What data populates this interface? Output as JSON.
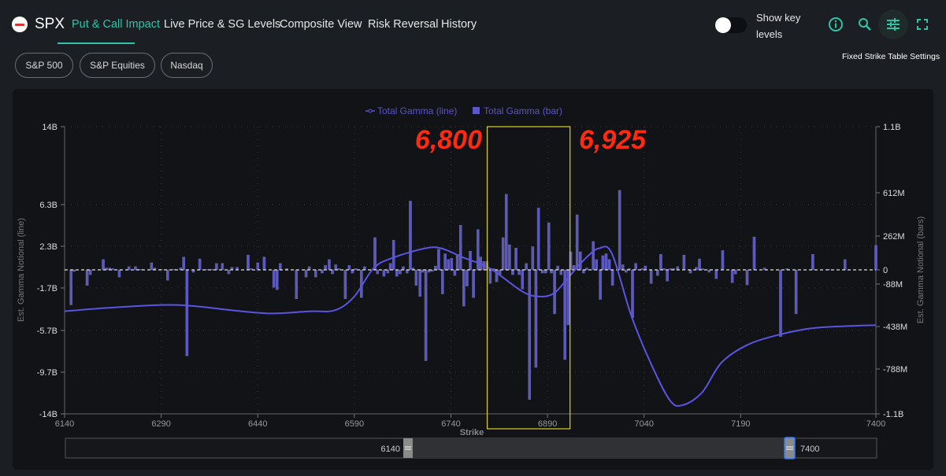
{
  "header": {
    "ticker": "SPX",
    "tabs": [
      {
        "label": "Put & Call Impact",
        "active": true
      },
      {
        "label": "Live Price & SG Levels",
        "active": false
      },
      {
        "label": "Composite View",
        "active": false
      },
      {
        "label": "Risk Reversal",
        "active": false
      },
      {
        "label": "History",
        "active": false
      }
    ],
    "toggle_label": "Show key levels",
    "toggle_on": false,
    "icons": [
      "info-icon",
      "search-icon",
      "sliders-icon",
      "fullscreen-icon"
    ],
    "tooltip": "Fixed Strike Table Settings",
    "accent": "#2ec4a6"
  },
  "filters": [
    "S&P 500",
    "S&P Equities",
    "Nasdaq"
  ],
  "annotations": {
    "left_label": "6,800",
    "right_label": "6,925",
    "range": [
      6800,
      6925
    ],
    "box_color": "#d8d02a",
    "label_color": "#ff2a0f"
  },
  "slider": {
    "min_label": "6140",
    "max_label": "7400",
    "min": 6140,
    "max": 7400
  },
  "chart_data": {
    "type": "bar+line",
    "xlabel": "Strike",
    "ylabel_left": "Est. Gamma Notional (line)",
    "ylabel_right": "Est. Gamma Notional (bars)",
    "x_ticks": [
      "6140",
      "6290",
      "6440",
      "6590",
      "6740",
      "6890",
      "7040",
      "7190",
      "7400"
    ],
    "x_tick_values": [
      6140,
      6290,
      6440,
      6590,
      6740,
      6890,
      7040,
      7190,
      7400
    ],
    "xlim": [
      6140,
      7400
    ],
    "left_ticks": [
      "14B",
      "6.3B",
      "2.3B",
      "-1.7B",
      "-5.7B",
      "-9.7B",
      "-14B"
    ],
    "left_tick_values": [
      14,
      6.3,
      2.3,
      -1.7,
      -5.7,
      -9.7,
      -14
    ],
    "right_ticks": [
      "1.1B",
      "612M",
      "262M",
      "0",
      "-88M",
      "-438M",
      "-788M",
      "-1.1B"
    ],
    "right_tick_values": [
      1100,
      612,
      262,
      0,
      -88,
      -438,
      -788,
      -1100
    ],
    "grid": true,
    "legend_position": "top-center",
    "series": [
      {
        "name": "Total Gamma (line)",
        "kind": "line",
        "axis": "left",
        "unit": "B",
        "color": "#5b54d6",
        "points": [
          [
            6140,
            -3.9
          ],
          [
            6200,
            -3.6
          ],
          [
            6290,
            -3.3
          ],
          [
            6340,
            -3.4
          ],
          [
            6400,
            -3.8
          ],
          [
            6460,
            -4.1
          ],
          [
            6520,
            -3.9
          ],
          [
            6560,
            -3.8
          ],
          [
            6590,
            -2.5
          ],
          [
            6620,
            0.2
          ],
          [
            6650,
            1.2
          ],
          [
            6700,
            2.1
          ],
          [
            6725,
            2.1
          ],
          [
            6760,
            1.2
          ],
          [
            6800,
            0.2
          ],
          [
            6850,
            -2.0
          ],
          [
            6875,
            -2.5
          ],
          [
            6900,
            -2.2
          ],
          [
            6925,
            -0.5
          ],
          [
            6950,
            1.2
          ],
          [
            6970,
            2.1
          ],
          [
            6990,
            1.6
          ],
          [
            7020,
            -4.3
          ],
          [
            7050,
            -8.8
          ],
          [
            7080,
            -12.6
          ],
          [
            7100,
            -13.1
          ],
          [
            7130,
            -11.8
          ],
          [
            7160,
            -8.8
          ],
          [
            7200,
            -7.1
          ],
          [
            7250,
            -6.1
          ],
          [
            7300,
            -5.5
          ],
          [
            7350,
            -5.3
          ],
          [
            7400,
            -5.2
          ]
        ]
      },
      {
        "name": "Total Gamma (bar)",
        "kind": "bar",
        "axis": "right",
        "unit": "M",
        "color": "#5b57c9",
        "points": [
          [
            6150,
            -260
          ],
          [
            6155,
            -10
          ],
          [
            6175,
            -100
          ],
          [
            6180,
            -30
          ],
          [
            6200,
            80
          ],
          [
            6205,
            15
          ],
          [
            6210,
            15
          ],
          [
            6215,
            10
          ],
          [
            6225,
            -45
          ],
          [
            6240,
            25
          ],
          [
            6250,
            25
          ],
          [
            6255,
            5
          ],
          [
            6260,
            5
          ],
          [
            6275,
            55
          ],
          [
            6280,
            15
          ],
          [
            6290,
            5
          ],
          [
            6300,
            -65
          ],
          [
            6310,
            5
          ],
          [
            6320,
            15
          ],
          [
            6325,
            100
          ],
          [
            6330,
            -680
          ],
          [
            6340,
            -15
          ],
          [
            6350,
            85
          ],
          [
            6360,
            5
          ],
          [
            6370,
            5
          ],
          [
            6376,
            50
          ],
          [
            6385,
            50
          ],
          [
            6395,
            -25
          ],
          [
            6400,
            20
          ],
          [
            6408,
            20
          ],
          [
            6425,
            115
          ],
          [
            6430,
            10
          ],
          [
            6440,
            55
          ],
          [
            6450,
            100
          ],
          [
            6465,
            -115
          ],
          [
            6470,
            -135
          ],
          [
            6475,
            50
          ],
          [
            6485,
            10
          ],
          [
            6500,
            -210
          ],
          [
            6515,
            -45
          ],
          [
            6520,
            25
          ],
          [
            6530,
            -45
          ],
          [
            6540,
            -20
          ],
          [
            6545,
            35
          ],
          [
            6551,
            80
          ],
          [
            6556,
            -25
          ],
          [
            6561,
            40
          ],
          [
            6566,
            10
          ],
          [
            6576,
            -210
          ],
          [
            6582,
            35
          ],
          [
            6587,
            -20
          ],
          [
            6592,
            10
          ],
          [
            6601,
            -200
          ],
          [
            6606,
            25
          ],
          [
            6622,
            250
          ],
          [
            6626,
            -25
          ],
          [
            6636,
            -40
          ],
          [
            6642,
            -20
          ],
          [
            6646,
            50
          ],
          [
            6651,
            230
          ],
          [
            6656,
            -40
          ],
          [
            6661,
            -25
          ],
          [
            6666,
            25
          ],
          [
            6672,
            -20
          ],
          [
            6677,
            545
          ],
          [
            6681,
            15
          ],
          [
            6686,
            -100
          ],
          [
            6692,
            -190
          ],
          [
            6696,
            -15
          ],
          [
            6701,
            -720
          ],
          [
            6706,
            -15
          ],
          [
            6711,
            -10
          ],
          [
            6716,
            30
          ],
          [
            6721,
            160
          ],
          [
            6727,
            -170
          ],
          [
            6731,
            125
          ],
          [
            6736,
            80
          ],
          [
            6741,
            90
          ],
          [
            6746,
            -35
          ],
          [
            6750,
            120
          ],
          [
            6755,
            350
          ],
          [
            6760,
            -270
          ],
          [
            6765,
            -105
          ],
          [
            6770,
            145
          ],
          [
            6775,
            -200
          ],
          [
            6782,
            315
          ],
          [
            6786,
            100
          ],
          [
            6791,
            65
          ],
          [
            6796,
            65
          ],
          [
            6801,
            -85
          ],
          [
            6806,
            10
          ],
          [
            6811,
            -75
          ],
          [
            6816,
            -30
          ],
          [
            6821,
            250
          ],
          [
            6826,
            600
          ],
          [
            6831,
            195
          ],
          [
            6836,
            -30
          ],
          [
            6841,
            170
          ],
          [
            6846,
            -30
          ],
          [
            6851,
            -130
          ],
          [
            6857,
            50
          ],
          [
            6862,
            -1000
          ],
          [
            6867,
            180
          ],
          [
            6872,
            -775
          ],
          [
            6876,
            490
          ],
          [
            6882,
            -20
          ],
          [
            6887,
            -20
          ],
          [
            6892,
            370
          ],
          [
            6896,
            -20
          ],
          [
            6901,
            -334
          ],
          [
            6906,
            30
          ],
          [
            6911,
            -30
          ],
          [
            6917,
            -710
          ],
          [
            6922,
            -425
          ],
          [
            6926,
            140
          ],
          [
            6931,
            35
          ],
          [
            6936,
            434
          ],
          [
            6941,
            140
          ],
          [
            6946,
            -20
          ],
          [
            6951,
            15
          ],
          [
            6961,
            220
          ],
          [
            6966,
            80
          ],
          [
            6972,
            -215
          ],
          [
            6976,
            110
          ],
          [
            6981,
            125
          ],
          [
            6986,
            80
          ],
          [
            6991,
            -100
          ],
          [
            7002,
            630
          ],
          [
            7007,
            40
          ],
          [
            7012,
            -15
          ],
          [
            7017,
            10
          ],
          [
            7022,
            -367
          ],
          [
            7027,
            50
          ],
          [
            7037,
            10
          ],
          [
            7042,
            30
          ],
          [
            7051,
            -85
          ],
          [
            7061,
            -35
          ],
          [
            7066,
            120
          ],
          [
            7071,
            10
          ],
          [
            7076,
            -70
          ],
          [
            7081,
            10
          ],
          [
            7086,
            10
          ],
          [
            7092,
            25
          ],
          [
            7102,
            115
          ],
          [
            7112,
            -20
          ],
          [
            7121,
            20
          ],
          [
            7126,
            85
          ],
          [
            7131,
            10
          ],
          [
            7141,
            -15
          ],
          [
            7152,
            -55
          ],
          [
            7162,
            150
          ],
          [
            7177,
            -80
          ],
          [
            7182,
            -25
          ],
          [
            7200,
            -95
          ],
          [
            7211,
            255
          ],
          [
            7227,
            15
          ],
          [
            7252,
            -522
          ],
          [
            7262,
            10
          ],
          [
            7276,
            -334
          ],
          [
            7302,
            120
          ],
          [
            7327,
            5
          ],
          [
            7352,
            80
          ],
          [
            7400,
            190
          ]
        ]
      }
    ]
  }
}
